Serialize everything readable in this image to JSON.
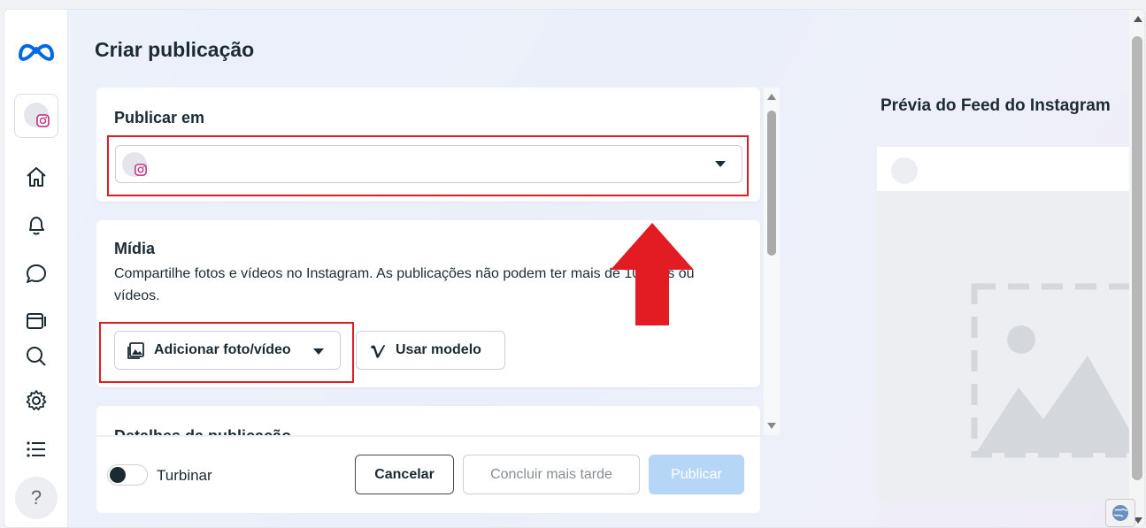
{
  "page": {
    "title": "Criar publicação"
  },
  "nav": {
    "items": [
      "home-icon",
      "bell-icon",
      "chat-icon",
      "media-icon",
      "search-icon",
      "gear-icon",
      "list-icon"
    ],
    "help_label": "?"
  },
  "publish_to": {
    "heading": "Publicar em"
  },
  "media": {
    "heading": "Mídia",
    "description": "Compartilhe fotos e vídeos no Instagram. As publicações não podem ter mais de 10 fotos ou vídeos.",
    "add_button": "Adicionar foto/vídeo",
    "template_button": "Usar modelo"
  },
  "details": {
    "heading": "Detalhes da publicação"
  },
  "footer": {
    "boost_label": "Turbinar",
    "cancel": "Cancelar",
    "finish_later": "Concluir mais tarde",
    "publish": "Publicar"
  },
  "preview": {
    "title": "Prévia do Feed do Instagram"
  },
  "colors": {
    "accent_red": "#e21c22",
    "publish_disabled": "#b6d6f8",
    "meta_blue": "#0668e1"
  }
}
